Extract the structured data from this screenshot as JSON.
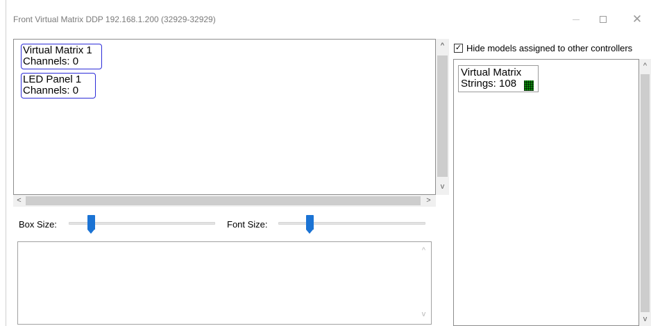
{
  "window": {
    "title": "Front Virtual Matrix DDP 192.168.1.200 (32929-32929)",
    "min_icon": "minimize-icon",
    "max_icon": "maximize-icon",
    "close_icon": "close-icon",
    "close_glyph": "✕"
  },
  "canvas": {
    "models": [
      {
        "name": "Virtual Matrix 1",
        "detail": "Channels: 0"
      },
      {
        "name": "LED Panel 1",
        "detail": "Channels: 0"
      }
    ]
  },
  "scroll": {
    "up": "^",
    "down": "v",
    "left": "<",
    "right": ">"
  },
  "sliders": {
    "box_size_label": "Box Size:",
    "font_size_label": "Font Size:",
    "box_size_value": 0.15,
    "font_size_value": 0.21
  },
  "right": {
    "hide_checkbox_label": "Hide models assigned to other controllers",
    "hide_checked": true,
    "check_glyph": "✓",
    "models": [
      {
        "name": "Virtual Matrix",
        "detail": "Strings: 108"
      }
    ]
  },
  "colors": {
    "model_border": "#2a2ad8",
    "slider_thumb": "#1b73d4",
    "matrix_green": "#0a8a0a"
  }
}
